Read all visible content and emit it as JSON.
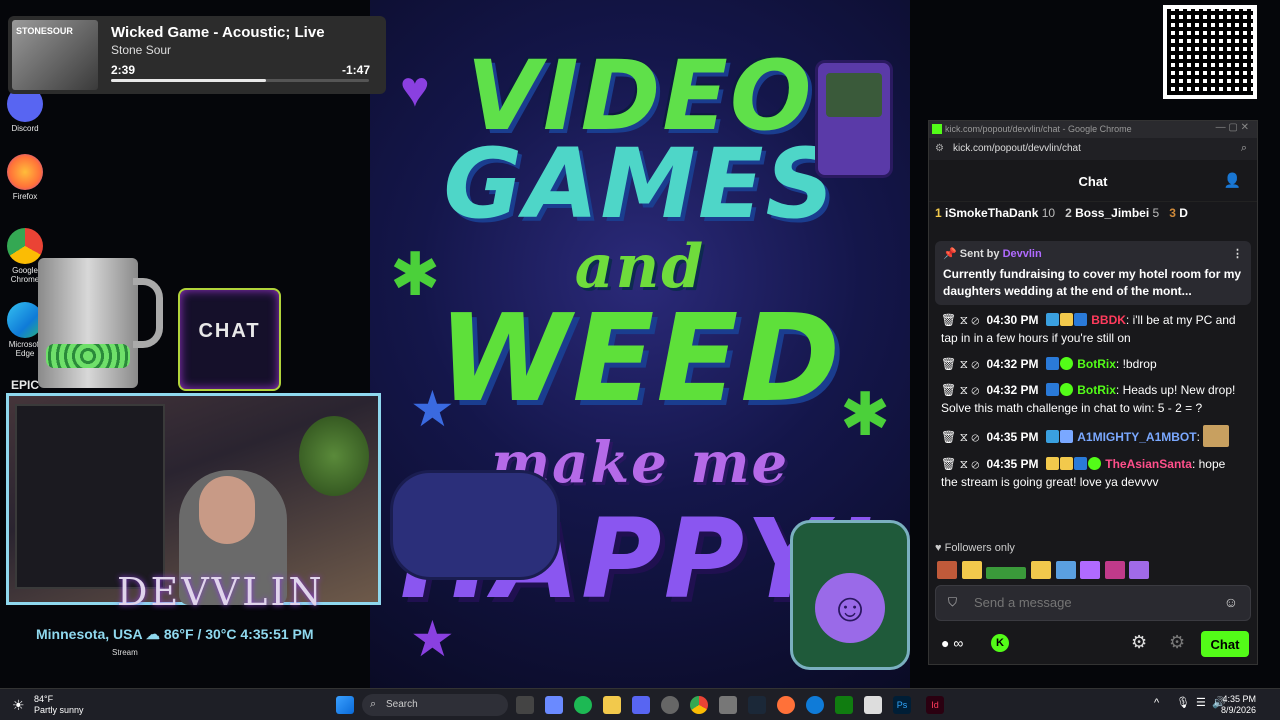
{
  "desktop": {
    "icons": [
      {
        "label": "Discord",
        "color": "#5865f2"
      },
      {
        "label": "Firefox",
        "color": "#ff7139"
      },
      {
        "label": "Google Chrome",
        "color": "#1a73e8"
      },
      {
        "label": "Microsoft Edge",
        "color": "#0f7bd8"
      },
      {
        "label": "EPIC"
      }
    ]
  },
  "media": {
    "title": "Wicked Game - Acoustic; Live",
    "artist": "Stone Sour",
    "album_art_text": "STONESOUR",
    "current": "2:39",
    "remaining": "-1:47",
    "progress": 0.6
  },
  "poster": {
    "line1": "VIDEO",
    "line2": "GAMES",
    "line3": "and",
    "line4": "WEED",
    "line5": "make me",
    "line6": "HAPPY!"
  },
  "overlay": {
    "streamer_name": "DEVVLIN",
    "weather": "Minnesota, USA ☁ 86°F / 30°C 4:35:51 PM",
    "stream_label": "Stream",
    "chat_box_text": "CHAT"
  },
  "browser": {
    "title": "kick.com/popout/devvlin/chat - Google Chrome",
    "address": "kick.com/popout/devvlin/chat"
  },
  "chat": {
    "header": "Chat",
    "leaderboard": [
      {
        "rank": "1",
        "name": "iSmokeThaDank",
        "count": "10"
      },
      {
        "rank": "2",
        "name": "Boss_Jimbei",
        "count": "5"
      },
      {
        "rank": "3",
        "name": "D",
        "count": ""
      }
    ],
    "pinned": {
      "sent_by_label": "Sent by",
      "sender": "Devvlin",
      "message": "Currently fundraising to cover my hotel room for my daughters wedding at the end of the mont..."
    },
    "messages": [
      {
        "time": "04:30 PM",
        "user": "BBDK",
        "user_class": "u-red",
        "text": "i'll be at my PC and tap in in a few hours if you're still on"
      },
      {
        "time": "04:32 PM",
        "user": "BotRix",
        "user_class": "u-green",
        "text": "!bdrop"
      },
      {
        "time": "04:32 PM",
        "user": "BotRix",
        "user_class": "u-green",
        "text": "Heads up! New drop! Solve this math challenge in chat to win: 5 - 2 = ?"
      },
      {
        "time": "04:35 PM",
        "user": "A1MIGHTY_A1MBOT",
        "user_class": "u-blue",
        "text": ""
      },
      {
        "time": "04:35 PM",
        "user": "TheAsianSanta",
        "user_class": "u-pink",
        "text": "hope the stream is going great! love ya devvvv"
      }
    ],
    "followers_only": "Followers only",
    "input_placeholder": "Send a message",
    "send_button": "Chat"
  },
  "taskbar": {
    "weather_temp": "84°F",
    "weather_desc": "Partly sunny",
    "search_label": "Search",
    "time": "4:35 PM",
    "date": "8/9/2026"
  },
  "colors": {
    "kick_green": "#53fc18",
    "chat_bg": "#18181b",
    "overlay_cyan": "#8fd8ee"
  }
}
